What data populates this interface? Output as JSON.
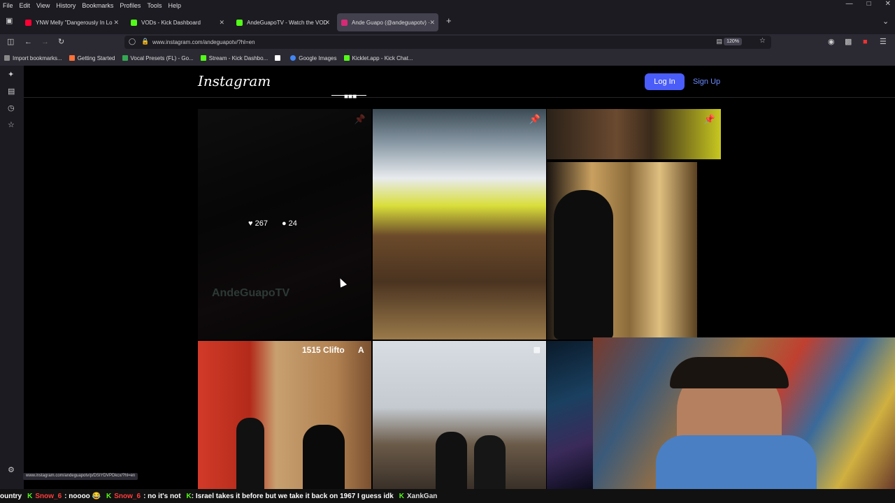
{
  "menubar": {
    "items": [
      "File",
      "Edit",
      "View",
      "History",
      "Bookmarks",
      "Profiles",
      "Tools",
      "Help"
    ]
  },
  "tabs": [
    {
      "title": "YNW Melly \"Dangerously In Lo",
      "color": "#ff0033"
    },
    {
      "title": "VODs - Kick Dashboard",
      "color": "#53fc18"
    },
    {
      "title": "AndeGuapoTV - Watch the VOD",
      "color": "#53fc18"
    },
    {
      "title": "Ande Guapo (@andeguapotv) ·",
      "color": "#d62976"
    }
  ],
  "new_tab": "+",
  "url": "www.instagram.com/andeguapotv/?hl=en",
  "zoom": "120%",
  "bookmarks": [
    {
      "label": "Import bookmarks...",
      "color": "#888"
    },
    {
      "label": "Getting Started",
      "color": "#ff7139"
    },
    {
      "label": "Vocal Presets (FL) - Go...",
      "color": "#34a853"
    },
    {
      "label": "Stream - Kick Dashbo...",
      "color": "#53fc18"
    },
    {
      "label": "",
      "color": "#fff"
    },
    {
      "label": "Google Images",
      "color": "#4285f4"
    },
    {
      "label": "Kicklet.app - Kick Chat...",
      "color": "#53fc18"
    }
  ],
  "instagram": {
    "logo": "Instagram",
    "login": "Log In",
    "signup": "Sign Up",
    "post_likes": "267",
    "post_comments": "24",
    "overlay_watermark": "AndeGuapoTV",
    "address_text": "1515 Clifto",
    "address_suffix": "A"
  },
  "status_url": "www.instagram.com/andeguapotv/p/DSIYDVPDkcx/?hl=en",
  "ticker": {
    "pre": "ountry",
    "m1_user": "Snow_6",
    "m1_text": ": noooo 😂",
    "m2_user": "Snow_6",
    "m2_text": ": no it's not",
    "m3_text": ": Israel takes it before but we take it back on 1967 I guess idk",
    "m4_user": "XankGan"
  },
  "colors": {
    "ig_blue": "#4a5df9",
    "kick_green": "#53fc18",
    "chrome_dark": "#1c1b22"
  }
}
